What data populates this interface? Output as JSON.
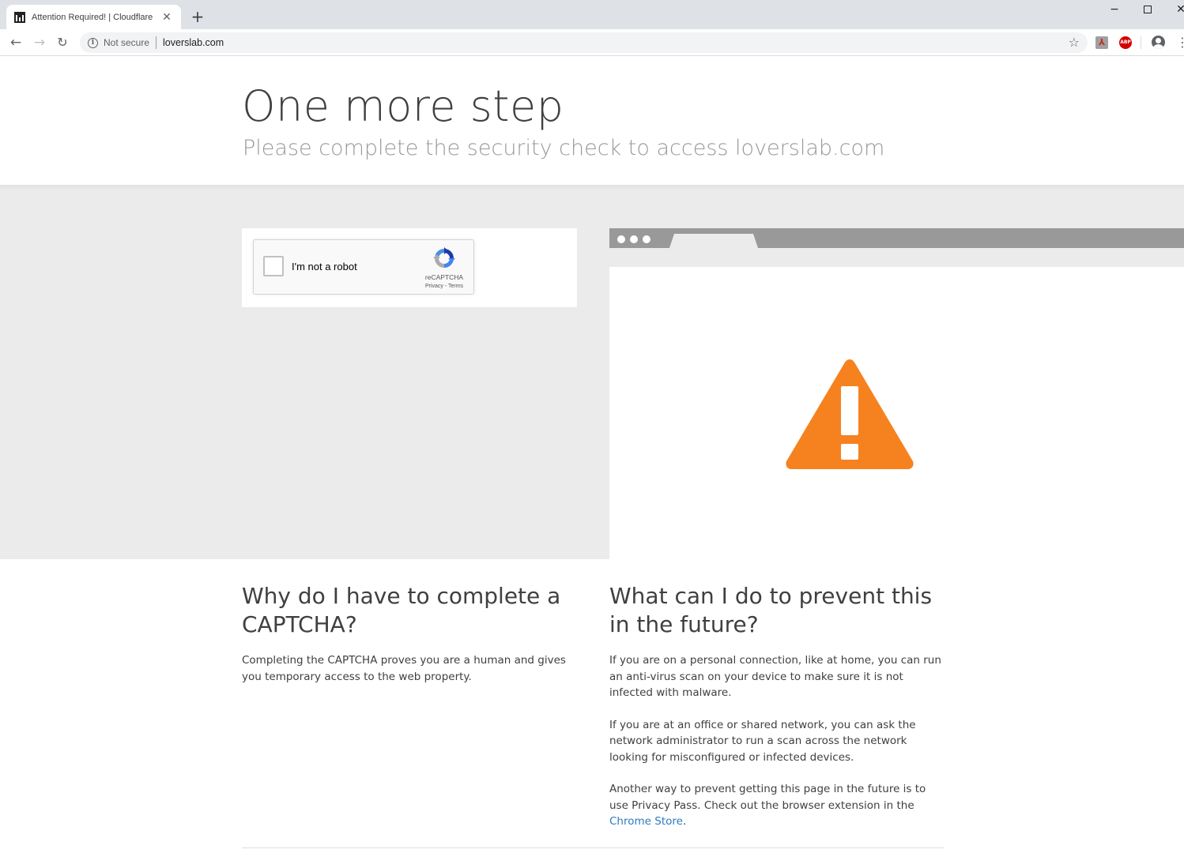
{
  "browser": {
    "tab_title": "Attention Required! | Cloudflare",
    "tab_close": "✕",
    "new_tab": "+",
    "window_min": "−",
    "window_close": "✕",
    "nav_back": "←",
    "nav_forward": "→",
    "nav_reload": "↻",
    "security_label": "Not secure",
    "url": "loverslab.com",
    "bookmark_star": "☆",
    "ext_abp": "ABP",
    "menu": "⋮"
  },
  "page": {
    "headline": "One more step",
    "subheadline": "Please complete the security check to access loverslab.com"
  },
  "recaptcha": {
    "label": "I'm not a robot",
    "brand": "reCAPTCHA",
    "links": "Privacy - Terms"
  },
  "why": {
    "heading": "Why do I have to complete a CAPTCHA?",
    "body": "Completing the CAPTCHA proves you are a human and gives you temporary access to the web property."
  },
  "prevent": {
    "heading": "What can I do to prevent this in the future?",
    "para1": "If you are on a personal connection, like at home, you can run an anti-virus scan on your device to make sure it is not infected with malware.",
    "para2": "If you are at an office or shared network, you can ask the network administrator to run a scan across the network looking for misconfigured or infected devices.",
    "para3_text": "Another way to prevent getting this page in the future is to use Privacy Pass. Check out the browser extension in the ",
    "para3_link": "Chrome Store",
    "para3_end": "."
  },
  "colors": {
    "warning": "#f6821f",
    "link": "#2f7bbf",
    "band": "#ebebeb"
  }
}
